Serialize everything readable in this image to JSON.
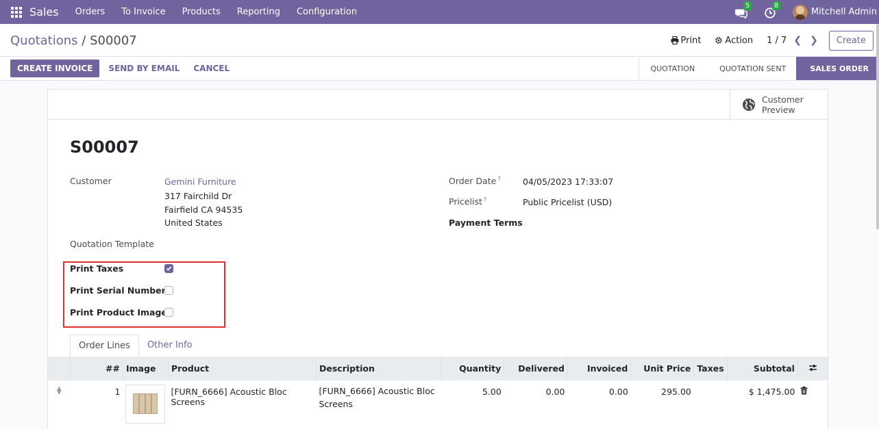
{
  "navbar": {
    "app_name": "Sales",
    "menu": [
      "Orders",
      "To Invoice",
      "Products",
      "Reporting",
      "Configuration"
    ],
    "messages_badge": "5",
    "activities_badge": "8",
    "user": "Mitchell Admin"
  },
  "control_panel": {
    "breadcrumb_parent": "Quotations",
    "breadcrumb_sep": " / ",
    "breadcrumb_current": "S00007",
    "print_label": "Print",
    "action_label": "Action",
    "pager": "1 / 7",
    "create_label": "Create"
  },
  "statusbar": {
    "buttons": {
      "create_invoice": "CREATE INVOICE",
      "send_by_email": "SEND BY EMAIL",
      "cancel": "CANCEL"
    },
    "stages": [
      "QUOTATION",
      "QUOTATION SENT",
      "SALES ORDER"
    ],
    "active_stage": "SALES ORDER"
  },
  "sheet": {
    "customer_preview": "Customer Preview",
    "order_name": "S00007",
    "customer_label": "Customer",
    "customer_name": "Gemini Furniture",
    "address": [
      "317 Fairchild Dr",
      "Fairfield CA 94535",
      "United States"
    ],
    "quotation_template_label": "Quotation Template",
    "order_date_label": "Order Date",
    "order_date": "04/05/2023 17:33:07",
    "pricelist_label": "Pricelist",
    "pricelist": "Public Pricelist (USD)",
    "payment_terms_label": "Payment Terms",
    "help_mark": "?",
    "options": {
      "print_taxes": {
        "label": "Print Taxes",
        "checked": true
      },
      "print_serial_number": {
        "label": "Print Serial Number",
        "checked": false
      },
      "print_product_image": {
        "label": "Print Product Image",
        "checked": false
      }
    }
  },
  "tabs": [
    "Order Lines",
    "Other Info"
  ],
  "table": {
    "headers": [
      "##",
      "Image",
      "Product",
      "Description",
      "Quantity",
      "Delivered",
      "Invoiced",
      "Unit Price",
      "Taxes",
      "Subtotal"
    ],
    "rows": [
      {
        "seq": "1",
        "product": "[FURN_6666] Acoustic Bloc Screens",
        "description_line1": "[FURN_6666] Acoustic Bloc",
        "description_line2": "Screens",
        "quantity": "5.00",
        "delivered": "0.00",
        "invoiced": "0.00",
        "unit_price": "295.00",
        "taxes": "",
        "subtotal": "$ 1,475.00"
      }
    ]
  },
  "colors": {
    "brand": "#71639e",
    "highlight": "#e02f2f",
    "badge": "#28a745"
  }
}
